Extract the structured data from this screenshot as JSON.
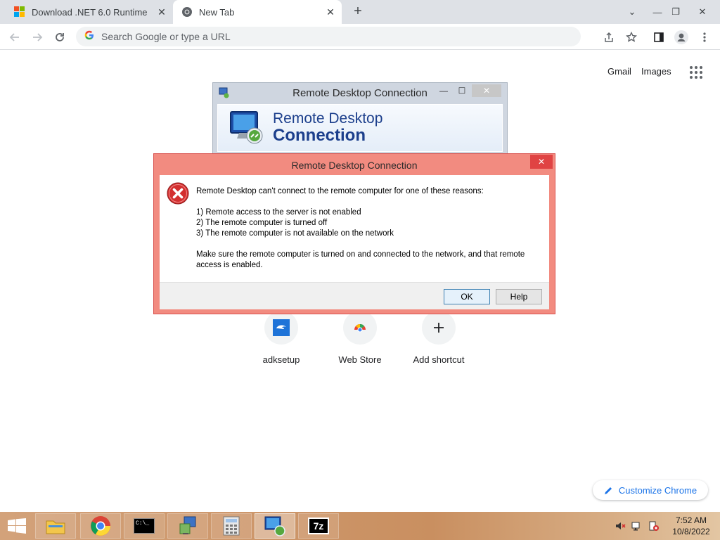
{
  "browser": {
    "tabs": [
      {
        "title": "Download .NET 6.0 Runtime",
        "active": false,
        "icon": "microsoft-logo"
      },
      {
        "title": "New Tab",
        "active": true,
        "icon": "chrome-icon"
      }
    ],
    "close_glyph": "✕",
    "new_tab_glyph": "+",
    "window_controls": {
      "dropdown": "⌄",
      "minimize": "—",
      "restore": "❐",
      "close": "✕"
    },
    "omnibox_placeholder": "Search Google or type a URL"
  },
  "ntp": {
    "links": {
      "gmail": "Gmail",
      "images": "Images"
    },
    "shortcuts": [
      {
        "label": "adksetup",
        "icon": "adk-icon"
      },
      {
        "label": "Web Store",
        "icon": "web-store-icon"
      },
      {
        "label": "Add shortcut",
        "icon": "plus-icon"
      }
    ],
    "customize_label": "Customize Chrome"
  },
  "rdc_window": {
    "title": "Remote Desktop Connection",
    "banner_line1": "Remote Desktop",
    "banner_line2": "Connection"
  },
  "error_dialog": {
    "title": "Remote Desktop Connection",
    "intro": "Remote Desktop can't connect to the remote computer for one of these reasons:",
    "reasons": [
      "1) Remote access to the server is not enabled",
      "2) The remote computer is turned off",
      "3) The remote computer is not available on the network"
    ],
    "advice": "Make sure the remote computer is turned on and connected to the network, and that remote access is enabled.",
    "ok_label": "OK",
    "help_label": "Help"
  },
  "taskbar": {
    "items": [
      "file-explorer-icon",
      "chrome-icon",
      "command-prompt-icon",
      "setup-installer-icon",
      "calculator-icon",
      "remote-desktop-icon",
      "7zip-icon"
    ],
    "sevenzip_text": "7z",
    "cmd_text": "C:\\_",
    "clock_time": "7:52 AM",
    "clock_date": "10/8/2022"
  },
  "colors": {
    "error_frame": "#f28b80",
    "chrome_accent": "#1a73e8",
    "rdc_banner_text": "#1c3f8c"
  }
}
